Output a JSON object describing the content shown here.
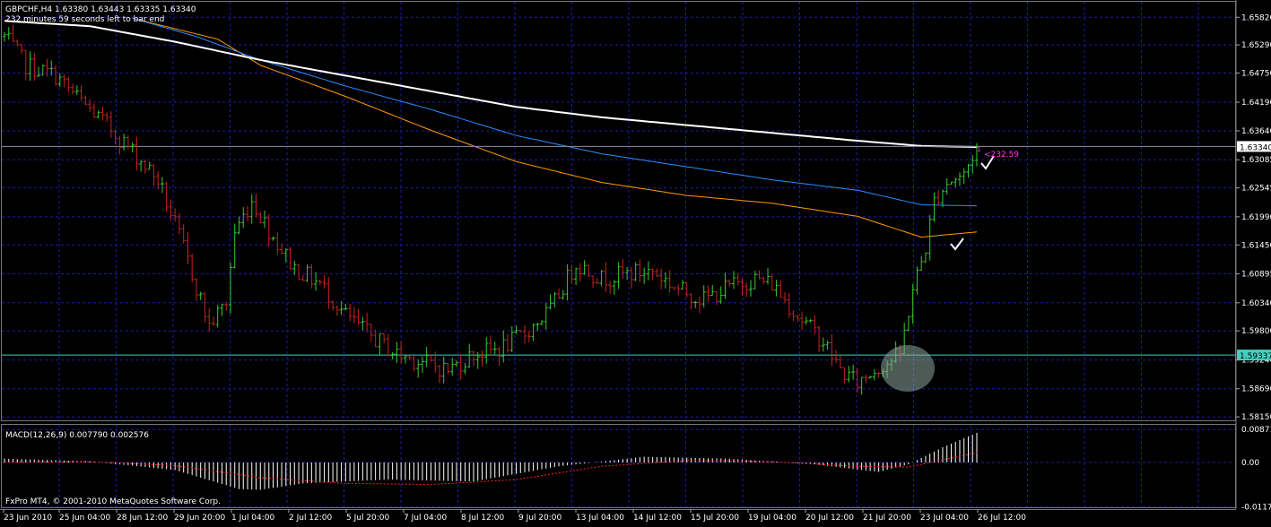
{
  "header": {
    "symbol_line": "GBPCHF,H4  1.63380 1.63443 1.63335 1.63340",
    "timer": "232 minutes 59 seconds left to bar end"
  },
  "footer": {
    "copyright": "FxPro MT4, © 2001-2010 MetaQuotes Software Corp."
  },
  "colors": {
    "background": "#000000",
    "grid": "#1c1ca8",
    "bull": "#33cc33",
    "bear": "#cc2222",
    "ma_white": "#ffffff",
    "ma_blue": "#2a8cff",
    "ma_orange": "#ff9900",
    "support_line": "#40d0c0",
    "macd_hist": "#ffffff",
    "macd_signal": "#ff2020",
    "annotation": "#ff33ff"
  },
  "chart_data": [
    {
      "type": "candlestick",
      "title": "GBPCHF,H4",
      "ohlc_current": {
        "open": 1.6338,
        "high": 1.63443,
        "low": 1.63335,
        "close": 1.6334
      },
      "y_ticks": [
        "1.65820",
        "1.65290",
        "1.64750",
        "1.64190",
        "1.63640",
        "1.63085",
        "1.62545",
        "1.61990",
        "1.61450",
        "1.60895",
        "1.60340",
        "1.59800",
        "1.59240",
        "1.58690",
        "1.58150"
      ],
      "ylim": [
        1.581,
        1.661
      ],
      "current_price_label": "1.63340",
      "current_price": 1.6334,
      "support_label": "1.59337",
      "support_price": 1.59337,
      "x_labels": [
        "23 Jun 2010",
        "25 Jun 04:00",
        "28 Jun 12:00",
        "29 Jun 20:00",
        "1 Jul 04:00",
        "2 Jul 12:00",
        "5 Jul 20:00",
        "7 Jul 04:00",
        "8 Jul 12:00",
        "9 Jul 20:00",
        "13 Jul 04:00",
        "14 Jul 12:00",
        "15 Jul 20:00",
        "19 Jul 04:00",
        "20 Jul 12:00",
        "21 Jul 20:00",
        "23 Jul 04:00",
        "26 Jul 12:00"
      ],
      "annotation": "<232.59",
      "close_anchors": [
        [
          0,
          1.6545
        ],
        [
          5,
          1.649
        ],
        [
          12,
          1.647
        ],
        [
          18,
          1.642
        ],
        [
          24,
          1.6375
        ],
        [
          30,
          1.6325
        ],
        [
          36,
          1.627
        ],
        [
          42,
          1.614
        ],
        [
          48,
          1.599
        ],
        [
          52,
          1.6035
        ],
        [
          54,
          1.617
        ],
        [
          58,
          1.623
        ],
        [
          63,
          1.616
        ],
        [
          68,
          1.61
        ],
        [
          74,
          1.607
        ],
        [
          80,
          1.601
        ],
        [
          86,
          1.597
        ],
        [
          92,
          1.5935
        ],
        [
          98,
          1.592
        ],
        [
          104,
          1.5905
        ],
        [
          110,
          1.5935
        ],
        [
          116,
          1.5945
        ],
        [
          122,
          1.5975
        ],
        [
          128,
          1.602
        ],
        [
          134,
          1.611
        ],
        [
          140,
          1.608
        ],
        [
          146,
          1.609
        ],
        [
          152,
          1.6095
        ],
        [
          158,
          1.606
        ],
        [
          164,
          1.604
        ],
        [
          170,
          1.6065
        ],
        [
          176,
          1.608
        ],
        [
          180,
          1.607
        ],
        [
          186,
          1.601
        ],
        [
          192,
          1.596
        ],
        [
          196,
          1.5905
        ],
        [
          200,
          1.588
        ],
        [
          204,
          1.5905
        ],
        [
          208,
          1.5925
        ],
        [
          210,
          1.5935
        ],
        [
          213,
          1.606
        ],
        [
          216,
          1.614
        ],
        [
          218,
          1.623
        ],
        [
          221,
          1.6265
        ],
        [
          225,
          1.628
        ],
        [
          228,
          1.6334
        ]
      ],
      "ma_white": [
        [
          0,
          1.6575
        ],
        [
          20,
          1.6565
        ],
        [
          40,
          1.6535
        ],
        [
          60,
          1.65
        ],
        [
          80,
          1.647
        ],
        [
          100,
          1.644
        ],
        [
          120,
          1.641
        ],
        [
          140,
          1.639
        ],
        [
          160,
          1.6375
        ],
        [
          180,
          1.636
        ],
        [
          200,
          1.6345
        ],
        [
          215,
          1.6335
        ],
        [
          228,
          1.6333
        ]
      ],
      "ma_blue": [
        [
          30,
          1.658
        ],
        [
          45,
          1.6545
        ],
        [
          60,
          1.65
        ],
        [
          80,
          1.645
        ],
        [
          100,
          1.6405
        ],
        [
          120,
          1.6355
        ],
        [
          140,
          1.632
        ],
        [
          160,
          1.6295
        ],
        [
          180,
          1.627
        ],
        [
          200,
          1.625
        ],
        [
          215,
          1.6222
        ],
        [
          228,
          1.622
        ]
      ],
      "ma_orange": [
        [
          30,
          1.658
        ],
        [
          50,
          1.654
        ],
        [
          60,
          1.649
        ],
        [
          80,
          1.643
        ],
        [
          100,
          1.6365
        ],
        [
          120,
          1.6305
        ],
        [
          140,
          1.6265
        ],
        [
          160,
          1.624
        ],
        [
          180,
          1.6225
        ],
        [
          200,
          1.62
        ],
        [
          215,
          1.616
        ],
        [
          228,
          1.617
        ]
      ]
    },
    {
      "type": "bar",
      "title": "MACD(12,26,9) 0.007790 0.002576",
      "y_ticks": [
        "0.00871",
        "0.00",
        "-0.01172"
      ],
      "ylim": [
        -0.0118,
        0.0092
      ],
      "hist_anchors": [
        [
          0,
          0.001
        ],
        [
          20,
          0.0003
        ],
        [
          40,
          -0.002
        ],
        [
          55,
          -0.007
        ],
        [
          60,
          -0.0072
        ],
        [
          70,
          -0.0055
        ],
        [
          90,
          -0.0045
        ],
        [
          110,
          -0.005
        ],
        [
          130,
          -0.001
        ],
        [
          150,
          0.0015
        ],
        [
          170,
          0.001
        ],
        [
          190,
          -0.0005
        ],
        [
          205,
          -0.0025
        ],
        [
          212,
          -0.0005
        ],
        [
          220,
          0.004
        ],
        [
          228,
          0.0078
        ]
      ],
      "signal_anchors": [
        [
          0,
          0.0
        ],
        [
          20,
          0.0002
        ],
        [
          40,
          -0.0008
        ],
        [
          60,
          -0.004
        ],
        [
          80,
          -0.0055
        ],
        [
          100,
          -0.0058
        ],
        [
          120,
          -0.0045
        ],
        [
          140,
          -0.001
        ],
        [
          160,
          0.0005
        ],
        [
          180,
          0.0002
        ],
        [
          200,
          -0.001
        ],
        [
          212,
          -0.0012
        ],
        [
          228,
          0.0026
        ]
      ]
    }
  ]
}
